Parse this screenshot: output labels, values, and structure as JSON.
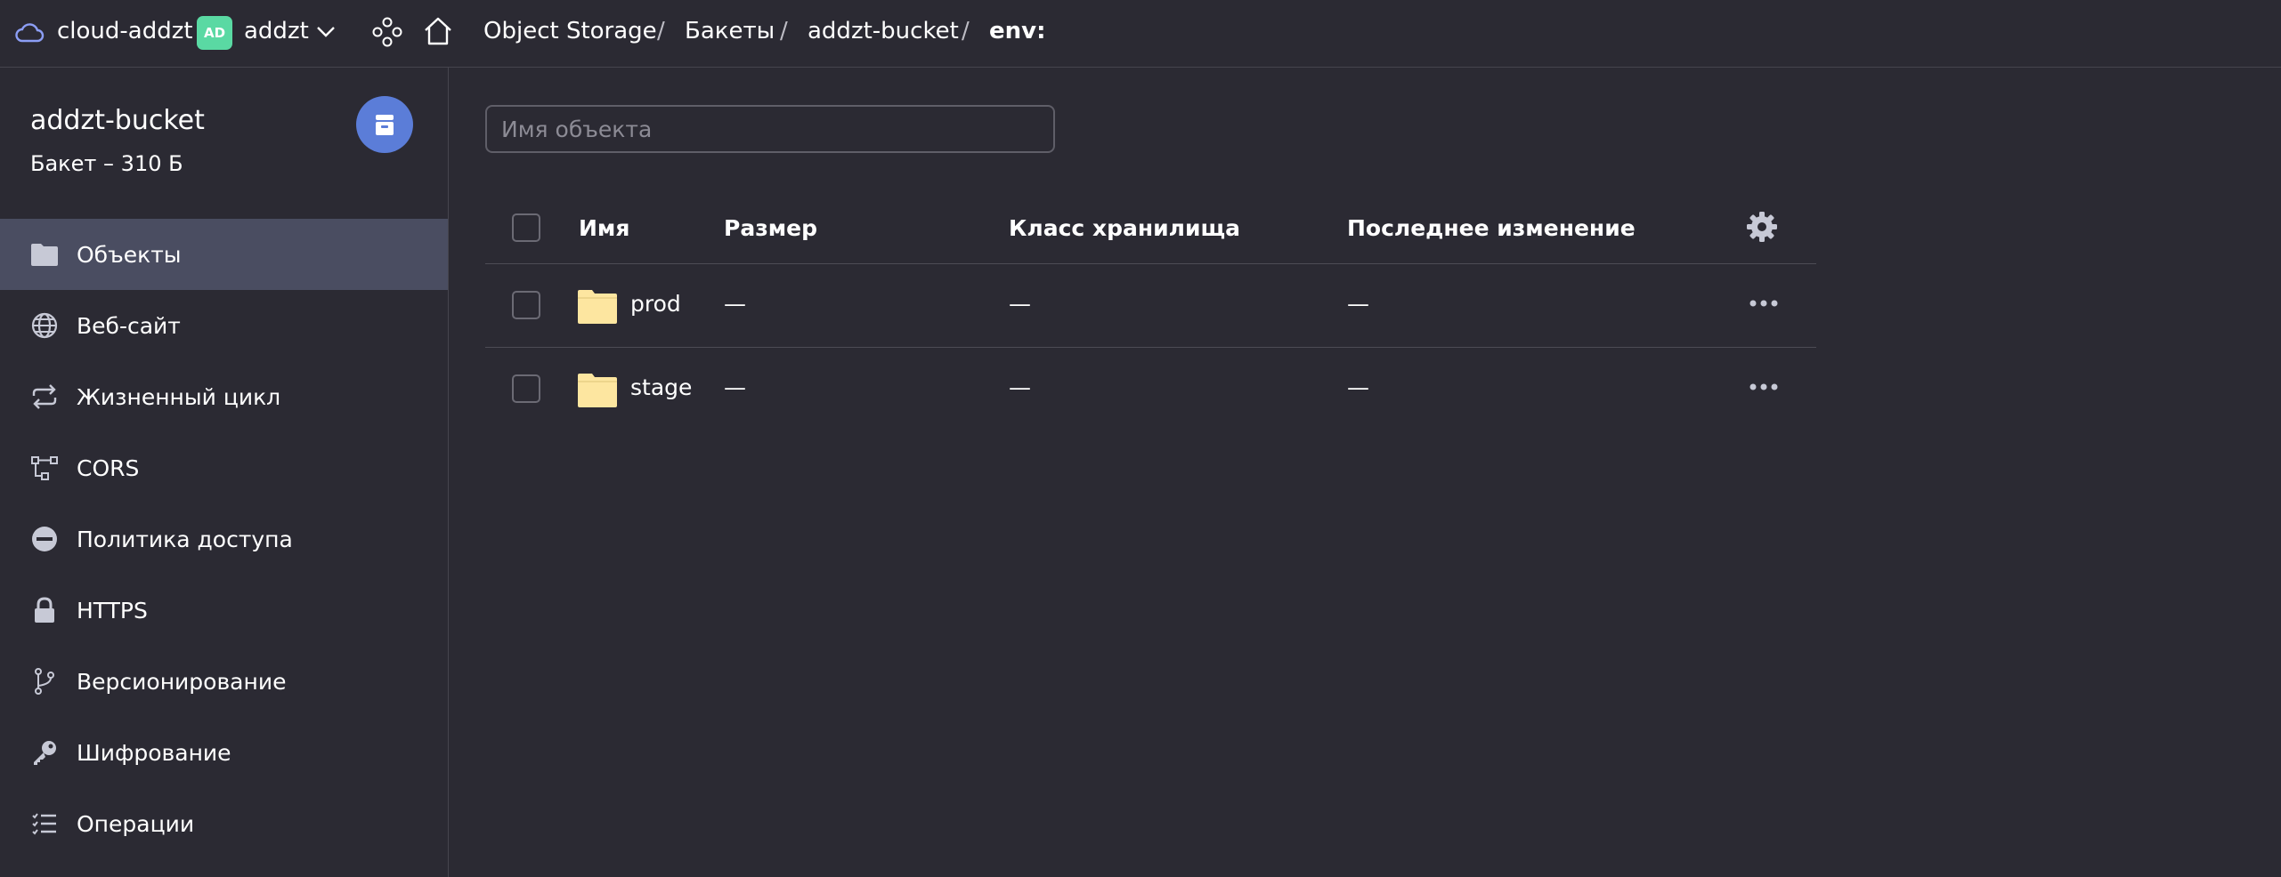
{
  "topbar": {
    "cloud_name": "cloud-addzt",
    "folder_avatar": "AD",
    "folder_name": "addzt",
    "breadcrumbs": [
      "Object Storage",
      "Бакеты",
      "addzt-bucket",
      "env:"
    ],
    "separator": "/"
  },
  "sidebar": {
    "bucket_name": "addzt-bucket",
    "bucket_subtitle": "Бакет – 310 Б",
    "items": [
      {
        "label": "Объекты",
        "icon": "folder-icon",
        "active": true
      },
      {
        "label": "Веб-сайт",
        "icon": "globe-icon",
        "active": false
      },
      {
        "label": "Жизненный цикл",
        "icon": "cycle-icon",
        "active": false
      },
      {
        "label": "CORS",
        "icon": "cors-icon",
        "active": false
      },
      {
        "label": "Политика доступа",
        "icon": "minus-circle-icon",
        "active": false
      },
      {
        "label": "HTTPS",
        "icon": "lock-icon",
        "active": false
      },
      {
        "label": "Версионирование",
        "icon": "branch-icon",
        "active": false
      },
      {
        "label": "Шифрование",
        "icon": "key-icon",
        "active": false
      },
      {
        "label": "Операции",
        "icon": "list-icon",
        "active": false
      }
    ]
  },
  "main": {
    "search_placeholder": "Имя объекта",
    "columns": [
      "Имя",
      "Размер",
      "Класс хранилища",
      "Последнее изменение"
    ],
    "rows": [
      {
        "name": "prod",
        "size": "—",
        "storage_class": "—",
        "modified": "—"
      },
      {
        "name": "stage",
        "size": "—",
        "storage_class": "—",
        "modified": "—"
      }
    ]
  },
  "colors": {
    "background": "#2b2a33",
    "active_nav": "#4a4d61",
    "bucket_avatar": "#5b7dd8",
    "folder_avatar": "#5ad9a3",
    "folder_icon": "#fde6a0"
  }
}
